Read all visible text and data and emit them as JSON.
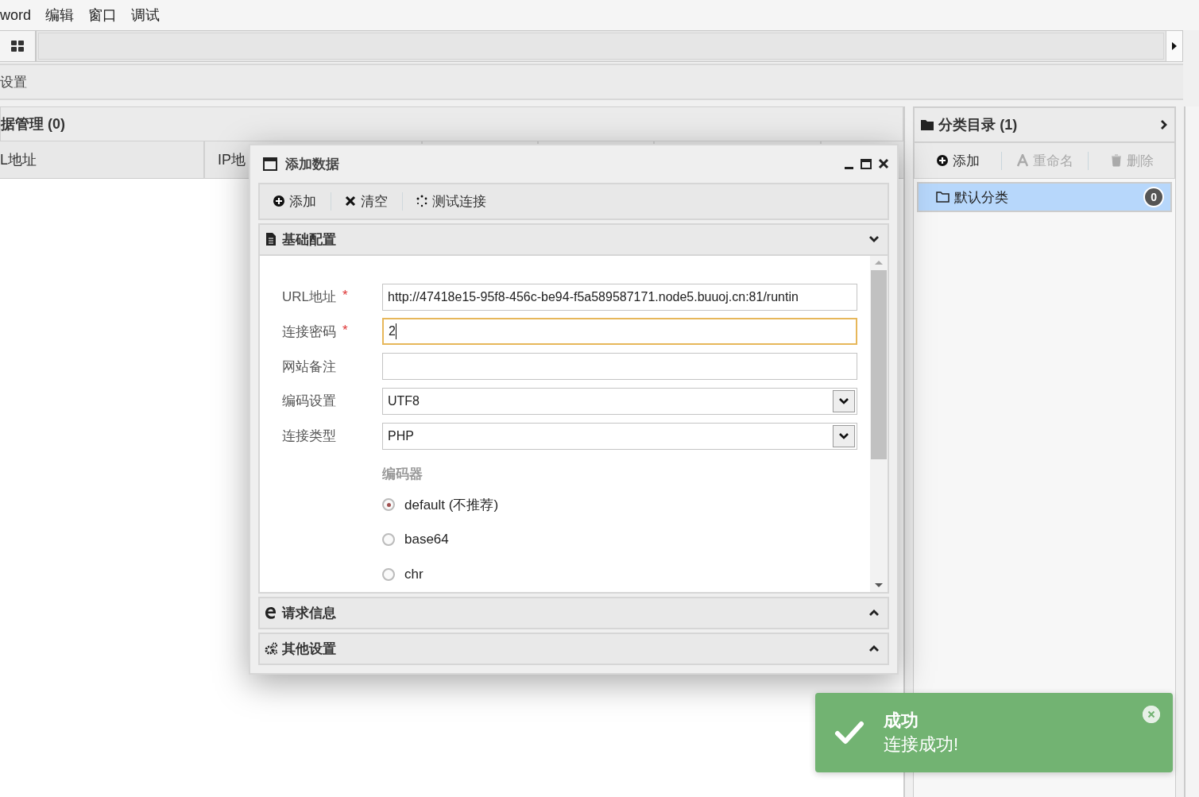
{
  "menu": [
    "word",
    "编辑",
    "窗口",
    "调试"
  ],
  "settings_bar": {
    "title": "设置"
  },
  "data_panel": {
    "title": "据管理 (0)",
    "columns": [
      "L地址",
      "IP地"
    ]
  },
  "category_panel": {
    "title": "分类目录 (1)",
    "toolbar": [
      {
        "label": "添加",
        "kind": "add",
        "disabled": false
      },
      {
        "label": "重命名",
        "kind": "rename",
        "disabled": true
      },
      {
        "label": "删除",
        "kind": "delete",
        "disabled": true
      }
    ],
    "items": [
      {
        "label": "默认分类",
        "count": "0",
        "selected": true
      }
    ]
  },
  "dialog": {
    "title": "添加数据",
    "toolbar": [
      {
        "label": "添加",
        "kind": "add"
      },
      {
        "label": "清空",
        "kind": "clear"
      },
      {
        "label": "测试连接",
        "kind": "test"
      }
    ],
    "sections": [
      {
        "title": "基础配置",
        "kind": "basic",
        "expanded": true
      },
      {
        "title": "请求信息",
        "kind": "request",
        "expanded": false
      },
      {
        "title": "其他设置",
        "kind": "other",
        "expanded": false
      }
    ],
    "fields": [
      {
        "label": "URL地址",
        "required_mark": "*",
        "kind": "text",
        "value": "http://47418e15-95f8-456c-be94-f5a589587171.node5.buuoj.cn:81/runtin",
        "focused": false
      },
      {
        "label": "连接密码",
        "required_mark": "*",
        "kind": "text",
        "value": "2",
        "focused": true
      },
      {
        "label": "网站备注",
        "kind": "text",
        "focused": false
      },
      {
        "label": "编码设置",
        "kind": "select",
        "value": "UTF8"
      },
      {
        "label": "连接类型",
        "kind": "select",
        "value": "PHP"
      }
    ],
    "encoder": {
      "label": "编码器",
      "options": [
        {
          "label": "default (不推荐)",
          "selected": true
        },
        {
          "label": "base64",
          "selected": false
        },
        {
          "label": "chr",
          "selected": false
        }
      ]
    }
  },
  "toast": {
    "title": "成功",
    "message": "连接成功!"
  }
}
